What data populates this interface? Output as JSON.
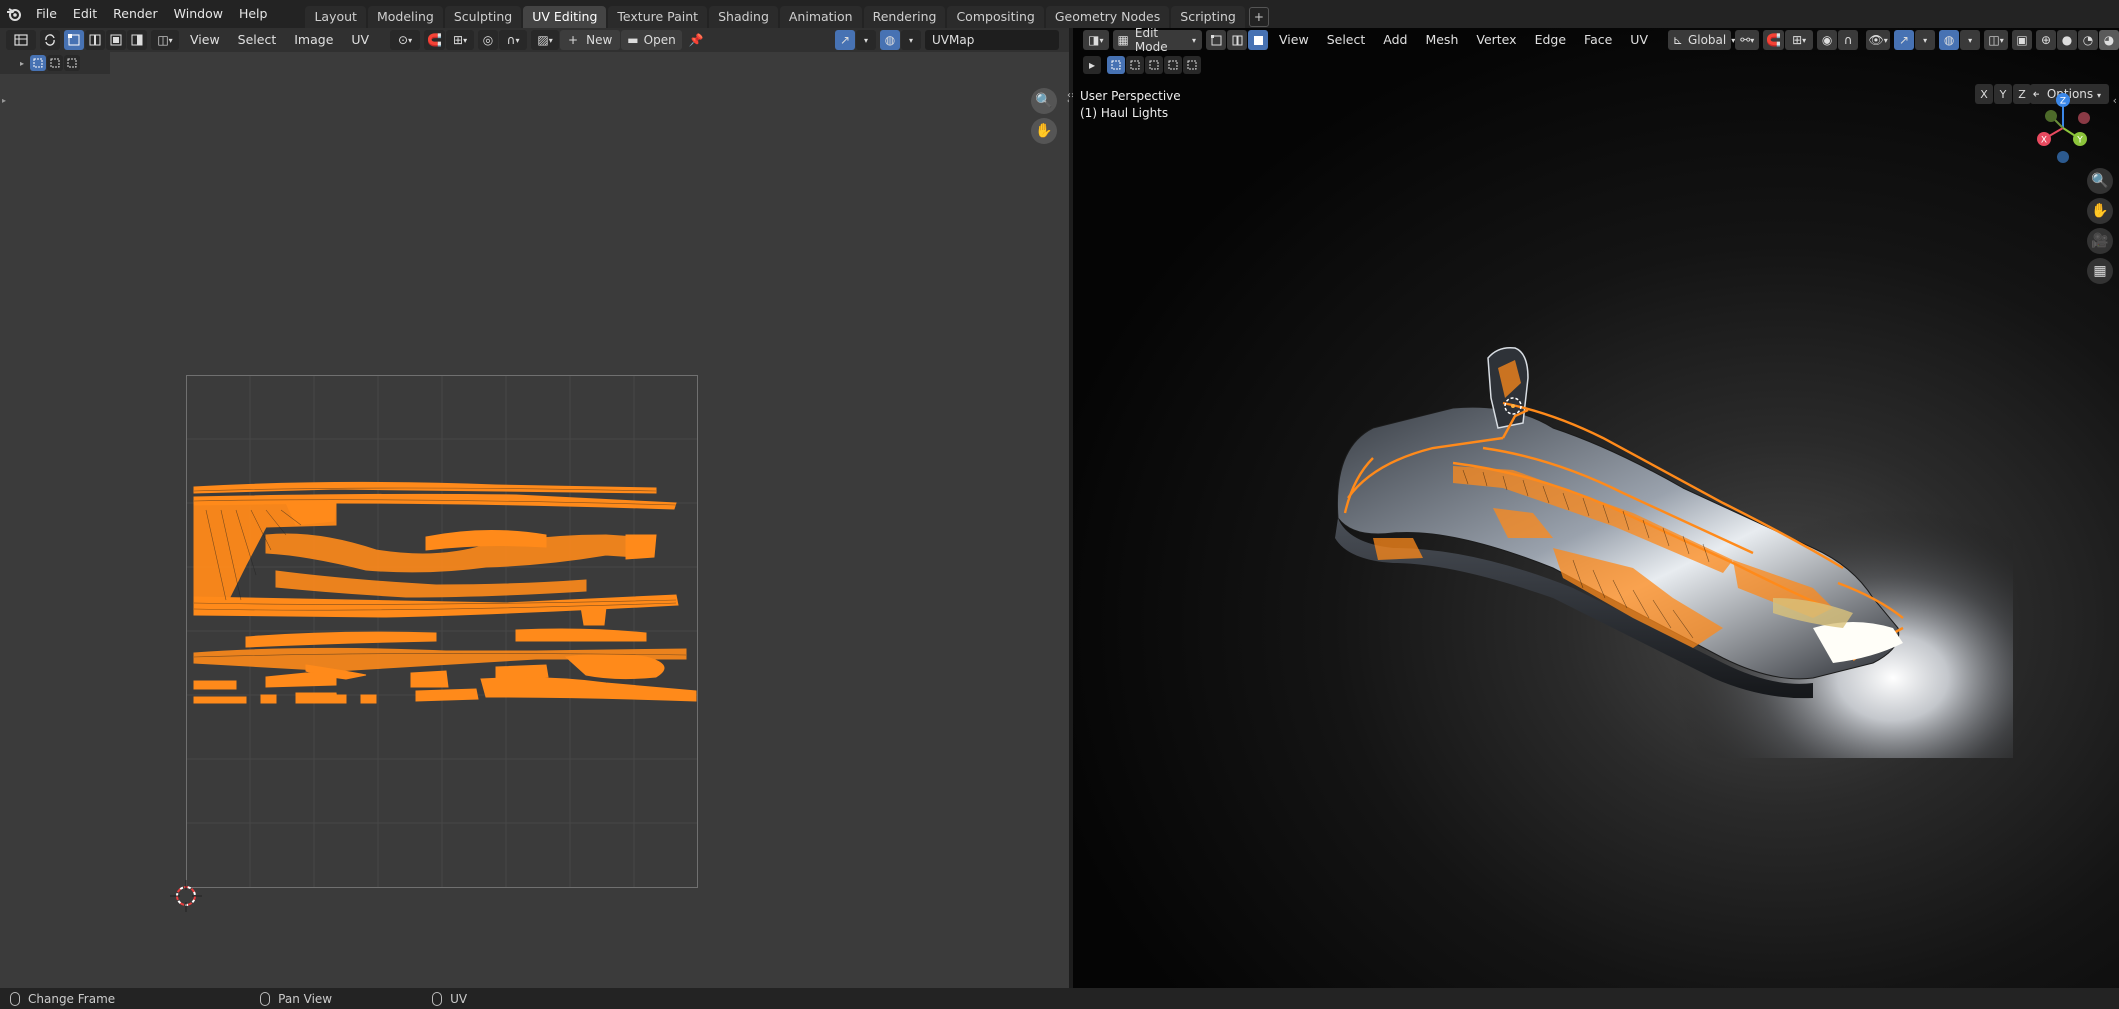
{
  "topbar": {
    "menu": [
      "File",
      "Edit",
      "Render",
      "Window",
      "Help"
    ],
    "tabs": [
      {
        "label": "Layout",
        "active": false
      },
      {
        "label": "Modeling",
        "active": false
      },
      {
        "label": "Sculpting",
        "active": false
      },
      {
        "label": "UV Editing",
        "active": true
      },
      {
        "label": "Texture Paint",
        "active": false
      },
      {
        "label": "Shading",
        "active": false
      },
      {
        "label": "Animation",
        "active": false
      },
      {
        "label": "Rendering",
        "active": false
      },
      {
        "label": "Compositing",
        "active": false
      },
      {
        "label": "Geometry Nodes",
        "active": false
      },
      {
        "label": "Scripting",
        "active": false
      }
    ],
    "add_tab": "+"
  },
  "uv_editor": {
    "menus": [
      "View",
      "Select",
      "Image",
      "UV"
    ],
    "new_label": "New",
    "open_label": "Open",
    "uvmap_name": "UVMap"
  },
  "viewport": {
    "mode": "Edit Mode",
    "menus": [
      "View",
      "Select",
      "Add",
      "Mesh",
      "Vertex",
      "Edge",
      "Face",
      "UV"
    ],
    "orientation": "Global",
    "perspective": "User Perspective",
    "object": "(1) Haul Lights",
    "axis_buttons": [
      "X",
      "Y",
      "Z"
    ],
    "options_label": "Options",
    "gizmo_axes": {
      "x": "X",
      "y": "Y",
      "z": "Z"
    }
  },
  "statusbar": {
    "items": [
      "Change Frame",
      "Pan View",
      "UV"
    ]
  },
  "colors": {
    "accent": "#4772b3",
    "uv_orange": "#ff8a1a",
    "x_axis": "#e84a5f",
    "y_axis": "#8cc43b",
    "z_axis": "#3b87e8"
  }
}
